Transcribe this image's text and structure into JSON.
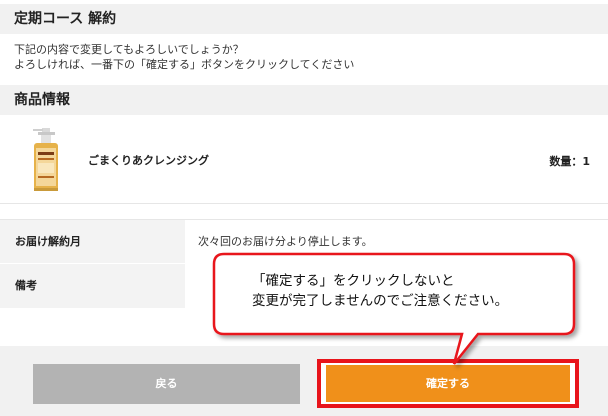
{
  "page": {
    "section1_title": "定期コース 解約",
    "description_line1": "下記の内容で変更してもよろしいでしょうか？",
    "description_line2": "よろしければ、一番下の「確定する」ボタンをクリックしてください",
    "section2_title": "商品情報"
  },
  "product": {
    "name": "ごまくりあクレンジング",
    "quantity": "数量：1"
  },
  "info": [
    {
      "label": "お届け解約月",
      "value": "次々回のお届け分より停止します。"
    },
    {
      "label": "備考",
      "value": ""
    }
  ],
  "buttons": {
    "back": "戻る",
    "confirm": "確定する"
  },
  "callout": {
    "line1": "「確定する」をクリックしないと",
    "line2": "変更が完了しませんのでご注意ください。"
  },
  "colors": {
    "confirm": "#f0901a",
    "highlight": "#e8141b",
    "back": "#b3b3b3"
  }
}
